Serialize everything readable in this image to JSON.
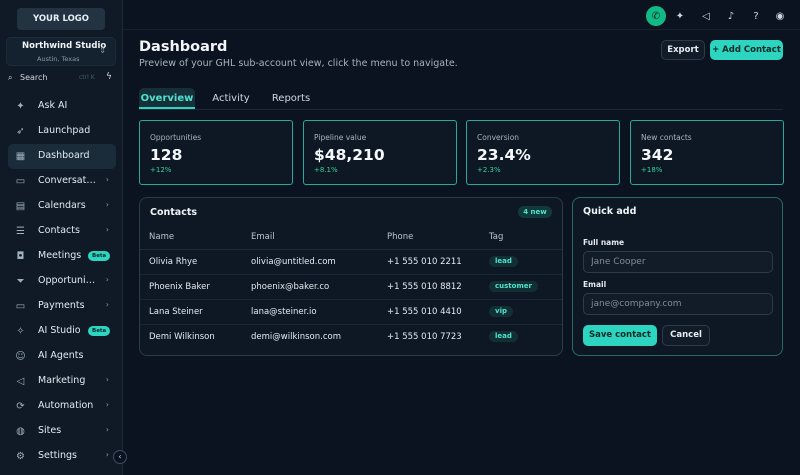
{
  "sidebar": {
    "logo": "YOUR LOGO",
    "account": {
      "name": "Northwind Studio",
      "location": "Austin, Texas"
    },
    "search": {
      "label": "Search",
      "shortcut": "ctrl K"
    },
    "items": [
      {
        "label": "Ask AI",
        "icon": "sparkles-icon"
      },
      {
        "label": "Launchpad",
        "icon": "rocket-icon"
      },
      {
        "label": "Dashboard",
        "icon": "grid-icon",
        "active": true
      },
      {
        "label": "Conversations",
        "icon": "chat-icon",
        "arrow": true
      },
      {
        "label": "Calendars",
        "icon": "calendar-icon",
        "arrow": true
      },
      {
        "label": "Contacts",
        "icon": "contacts-icon",
        "arrow": true
      },
      {
        "label": "Meetings",
        "icon": "video-icon",
        "badge": "Beta"
      },
      {
        "label": "Opportunities",
        "icon": "funnel-icon",
        "arrow": true
      },
      {
        "label": "Payments",
        "icon": "card-icon",
        "arrow": true
      },
      {
        "label": "AI Studio",
        "icon": "wand-icon",
        "badge": "Beta"
      },
      {
        "label": "AI Agents",
        "icon": "bot-icon"
      },
      {
        "label": "Marketing",
        "icon": "megaphone-icon",
        "arrow": true
      },
      {
        "label": "Automation",
        "icon": "workflow-icon",
        "arrow": true
      },
      {
        "label": "Sites",
        "icon": "globe-icon",
        "arrow": true
      },
      {
        "label": "Settings",
        "icon": "gear-icon",
        "arrow": true
      }
    ]
  },
  "header": {
    "title": "Dashboard",
    "subtitle": "Preview of your GHL sub-account view, click the menu to navigate.",
    "export_label": "Export",
    "add_contact_label": "+ Add Contact"
  },
  "tabs": [
    "Overview",
    "Activity",
    "Reports"
  ],
  "stats": [
    {
      "label": "Opportunities",
      "value": "128",
      "delta": "+12%"
    },
    {
      "label": "Pipeline value",
      "value": "$48,210",
      "delta": "+8.1%"
    },
    {
      "label": "Conversion",
      "value": "23.4%",
      "delta": "+2.3%"
    },
    {
      "label": "New contacts",
      "value": "342",
      "delta": "+18%"
    }
  ],
  "contacts": {
    "title": "Contacts",
    "badge": "4 new",
    "columns": [
      "Name",
      "Email",
      "Phone",
      "Tag"
    ],
    "rows": [
      {
        "name": "Olivia Rhye",
        "email": "olivia@untitled.com",
        "phone": "+1 555 010 2211",
        "tag": "lead"
      },
      {
        "name": "Phoenix Baker",
        "email": "phoenix@baker.co",
        "phone": "+1 555 010 8812",
        "tag": "customer"
      },
      {
        "name": "Lana Steiner",
        "email": "lana@steiner.io",
        "phone": "+1 555 010 4410",
        "tag": "vip"
      },
      {
        "name": "Demi Wilkinson",
        "email": "demi@wilkinson.com",
        "phone": "+1 555 010 7723",
        "tag": "lead"
      }
    ]
  },
  "quick_add": {
    "title": "Quick add",
    "fullname_label": "Full name",
    "fullname_placeholder": "Jane Cooper",
    "email_label": "Email",
    "email_placeholder": "jane@company.com",
    "save_label": "Save contact",
    "cancel_label": "Cancel"
  },
  "colors": {
    "accent": "#2dd4bf",
    "background": "#0b1220",
    "positive": "#34d399"
  }
}
